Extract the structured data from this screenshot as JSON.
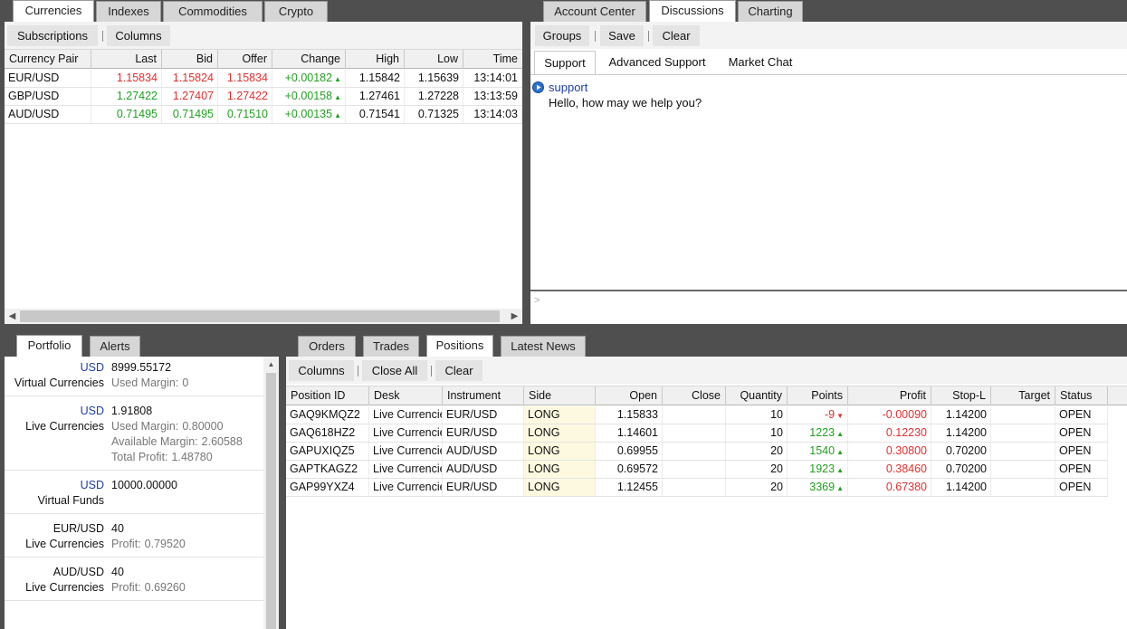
{
  "currencies_panel": {
    "tabs": [
      "Currencies",
      "Indexes",
      "Commodities",
      "Crypto"
    ],
    "toolbar": {
      "subscriptions": "Subscriptions",
      "columns": "Columns"
    },
    "columns": [
      "Currency Pair",
      "Last",
      "Bid",
      "Offer",
      "Change",
      "High",
      "Low",
      "Time"
    ],
    "rows": [
      {
        "pair": "EUR/USD",
        "last": "1.15834",
        "bid": "1.15824",
        "offer": "1.15834",
        "change": "+0.00182",
        "high": "1.15842",
        "low": "1.15639",
        "time": "13:14:01"
      },
      {
        "pair": "GBP/USD",
        "last": "1.27422",
        "bid": "1.27407",
        "offer": "1.27422",
        "change": "+0.00158",
        "high": "1.27461",
        "low": "1.27228",
        "time": "13:13:59"
      },
      {
        "pair": "AUD/USD",
        "last": "0.71495",
        "bid": "0.71495",
        "offer": "0.71510",
        "change": "+0.00135",
        "high": "0.71541",
        "low": "0.71325",
        "time": "13:14:03"
      }
    ]
  },
  "discussions_panel": {
    "tabs": [
      "Account Center",
      "Discussions",
      "Charting"
    ],
    "toolbar": {
      "groups": "Groups",
      "save": "Save",
      "clear": "Clear"
    },
    "subtabs": [
      "Support",
      "Advanced Support",
      "Market Chat"
    ],
    "message": {
      "author": "support",
      "text": "Hello, how may we help you?"
    },
    "input_prompt": ">"
  },
  "portfolio_panel": {
    "tabs": [
      "Portfolio",
      "Alerts"
    ],
    "items": [
      {
        "currency": "USD",
        "value": "8999.55172",
        "name": "Virtual Currencies",
        "details": [
          {
            "label": "Used Margin:",
            "value": "0"
          }
        ]
      },
      {
        "currency": "USD",
        "value": "1.91808",
        "name": "Live Currencies",
        "details": [
          {
            "label": "Used Margin:",
            "value": "0.80000"
          },
          {
            "label": "Available Margin:",
            "value": "2.60588"
          },
          {
            "label": "Total Profit:",
            "value": "1.48780"
          }
        ]
      },
      {
        "currency": "USD",
        "value": "10000.00000",
        "name": "Virtual Funds",
        "details": []
      },
      {
        "currency": "EUR/USD",
        "value": "40",
        "name": "Live Currencies",
        "details": [
          {
            "label": "Profit:",
            "value": "0.79520"
          }
        ]
      },
      {
        "currency": "AUD/USD",
        "value": "40",
        "name": "Live Currencies",
        "details": [
          {
            "label": "Profit:",
            "value": "0.69260"
          }
        ]
      }
    ]
  },
  "positions_panel": {
    "tabs": [
      "Orders",
      "Trades",
      "Positions",
      "Latest News"
    ],
    "toolbar": {
      "columns": "Columns",
      "close_all": "Close All",
      "clear": "Clear"
    },
    "columns": [
      "Position ID",
      "Desk",
      "Instrument",
      "Side",
      "Open",
      "Close",
      "Quantity",
      "Points",
      "Profit",
      "Stop-L",
      "Target",
      "Status"
    ],
    "rows": [
      {
        "id": "GAQ9KMQZ2",
        "desk": "Live Currencies",
        "instrument": "EUR/USD",
        "side": "LONG",
        "open": "1.15833",
        "close": "",
        "quantity": "10",
        "points": "-9",
        "dir": "down",
        "profit": "-0.00090",
        "stop": "1.14200",
        "target": "",
        "status": "OPEN"
      },
      {
        "id": "GAQ618HZ2",
        "desk": "Live Currencies",
        "instrument": "EUR/USD",
        "side": "LONG",
        "open": "1.14601",
        "close": "",
        "quantity": "10",
        "points": "1223",
        "dir": "up",
        "profit": "0.12230",
        "stop": "1.14200",
        "target": "",
        "status": "OPEN"
      },
      {
        "id": "GAPUXIQZ5",
        "desk": "Live Currencies",
        "instrument": "AUD/USD",
        "side": "LONG",
        "open": "0.69955",
        "close": "",
        "quantity": "20",
        "points": "1540",
        "dir": "up",
        "profit": "0.30800",
        "stop": "0.70200",
        "target": "",
        "status": "OPEN"
      },
      {
        "id": "GAPTKAGZ2",
        "desk": "Live Currencies",
        "instrument": "AUD/USD",
        "side": "LONG",
        "open": "0.69572",
        "close": "",
        "quantity": "20",
        "points": "1923",
        "dir": "up",
        "profit": "0.38460",
        "stop": "0.70200",
        "target": "",
        "status": "OPEN"
      },
      {
        "id": "GAP99YXZ4",
        "desk": "Live Currencies",
        "instrument": "EUR/USD",
        "side": "LONG",
        "open": "1.12455",
        "close": "",
        "quantity": "20",
        "points": "3369",
        "dir": "up",
        "profit": "0.67380",
        "stop": "1.14200",
        "target": "",
        "status": "OPEN"
      }
    ]
  }
}
